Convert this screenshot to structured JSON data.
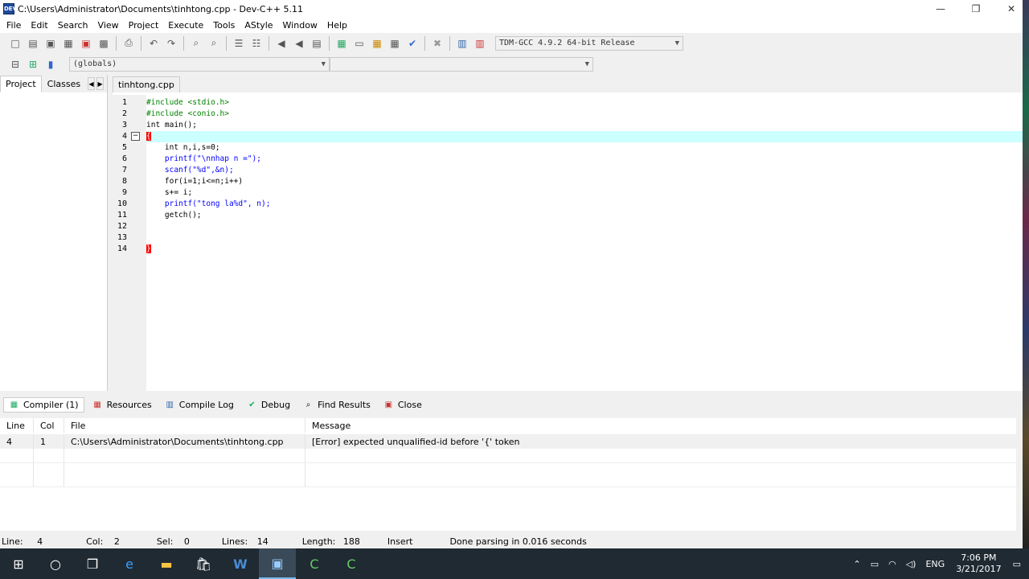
{
  "window": {
    "title": "C:\\Users\\Administrator\\Documents\\tinhtong.cpp - Dev-C++ 5.11",
    "icon_label": "DEV"
  },
  "window_buttons": {
    "minimize": "—",
    "restore": "❐",
    "close": "✕"
  },
  "menu": [
    "File",
    "Edit",
    "Search",
    "View",
    "Project",
    "Execute",
    "Tools",
    "AStyle",
    "Window",
    "Help"
  ],
  "toolbar": {
    "compiler_select": "TDM-GCC 4.9.2 64-bit Release",
    "scope_select": "(globals)",
    "member_select": ""
  },
  "left_panel": {
    "tabs": [
      "Project",
      "Classes"
    ],
    "nav_prev": "◀",
    "nav_next": "▶"
  },
  "editor": {
    "tab_label": "tinhtong.cpp",
    "lines": [
      {
        "num": "1",
        "text": "#include <stdio.h>"
      },
      {
        "num": "2",
        "text": "#include <conio.h>"
      },
      {
        "num": "3",
        "text": "int main();"
      },
      {
        "num": "4",
        "text": "{"
      },
      {
        "num": "5",
        "text": "    int n,i,s=0;"
      },
      {
        "num": "6",
        "text": "    printf(\"\\nnhap n =\");"
      },
      {
        "num": "7",
        "text": "    scanf(\"%d\",&n);"
      },
      {
        "num": "8",
        "text": "    for(i=1;i<=n;i++)"
      },
      {
        "num": "9",
        "text": "    s+= i;"
      },
      {
        "num": "10",
        "text": "    printf(\"tong la%d\", n);"
      },
      {
        "num": "11",
        "text": "    getch();"
      },
      {
        "num": "12",
        "text": ""
      },
      {
        "num": "13",
        "text": ""
      },
      {
        "num": "14",
        "text": "}"
      }
    ],
    "fold_glyph": "−"
  },
  "bottom_tabs": [
    "Compiler (1)",
    "Resources",
    "Compile Log",
    "Debug",
    "Find Results",
    "Close"
  ],
  "messages": {
    "headers": [
      "Line",
      "Col",
      "File",
      "Message"
    ],
    "rows": [
      {
        "line": "4",
        "col": "1",
        "file": "C:\\Users\\Administrator\\Documents\\tinhtong.cpp",
        "message": "[Error] expected unqualified-id before '{' token"
      }
    ]
  },
  "status": {
    "line_label": "Line:",
    "line": "4",
    "col_label": "Col:",
    "col": "2",
    "sel_label": "Sel:",
    "sel": "0",
    "lines_label": "Lines:",
    "lines": "14",
    "length_label": "Length:",
    "length": "188",
    "mode": "Insert",
    "message": "Done parsing in 0.016 seconds"
  },
  "taskbar": {
    "lang": "ENG",
    "time": "7:06 PM",
    "date": "3/21/2017"
  }
}
